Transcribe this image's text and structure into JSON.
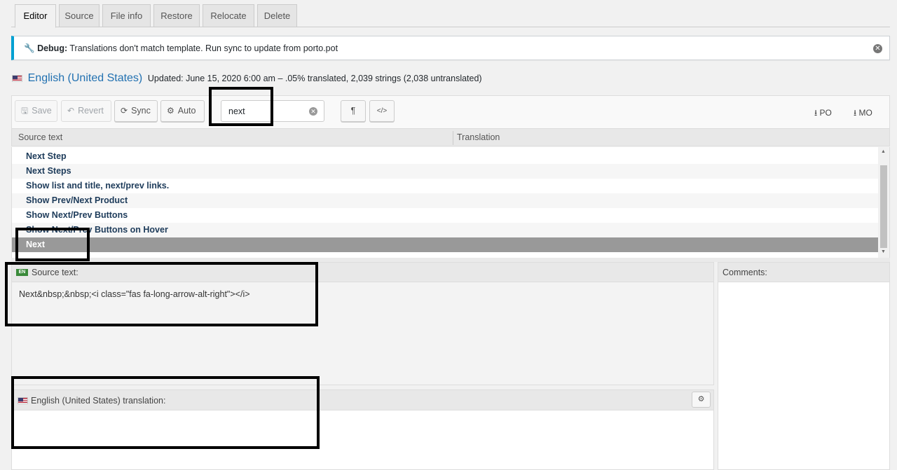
{
  "tabs": [
    "Editor",
    "Source",
    "File info",
    "Restore",
    "Relocate",
    "Delete"
  ],
  "notice": {
    "label": "Debug:",
    "message": "Translations don't match template. Run sync to update from porto.pot"
  },
  "language": {
    "name": "English (United States)",
    "meta": "Updated: June 15, 2020 6:00 am – .05% translated, 2,039 strings (2,038 untranslated)"
  },
  "toolbar": {
    "save": "Save",
    "revert": "Revert",
    "sync": "Sync",
    "auto": "Auto",
    "search_value": "next",
    "pilcrow": "¶",
    "code": "</>",
    "download_po": "PO",
    "download_mo": "MO"
  },
  "grid": {
    "col_source": "Source text",
    "col_translation": "Translation",
    "rows": [
      "Next Step",
      "Next Steps",
      "Show list and title, next/prev links.",
      "Show Prev/Next Product",
      "Show Next/Prev Buttons",
      "Show Next/Prev Buttons on Hover",
      "Next"
    ]
  },
  "source_pane": {
    "badge": "EN",
    "title": "Source text:",
    "text": "Next&nbsp;&nbsp;<i class=\"fas fa-long-arrow-alt-right\"></i>"
  },
  "comments": {
    "title": "Comments:"
  },
  "translation_pane": {
    "title": "English (United States) translation:"
  }
}
